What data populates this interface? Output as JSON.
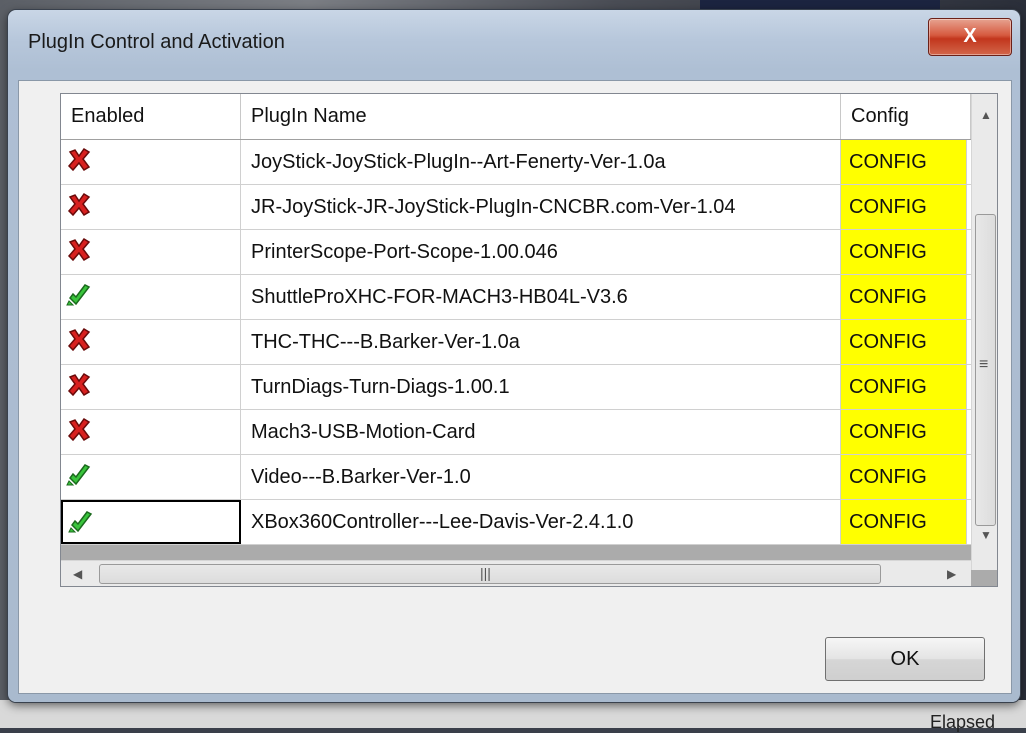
{
  "window": {
    "title": "PlugIn Control and Activation",
    "close_label": "X"
  },
  "grid": {
    "headers": {
      "enabled": "Enabled",
      "name": "PlugIn Name",
      "config": "Config"
    },
    "config_color": "#ffff00",
    "rows": [
      {
        "enabled": false,
        "name": "JoyStick-JoyStick-PlugIn--Art-Fenerty-Ver-1.0a",
        "config": "CONFIG"
      },
      {
        "enabled": false,
        "name": "JR-JoyStick-JR-JoyStick-PlugIn-CNCBR.com-Ver-1.04",
        "config": "CONFIG"
      },
      {
        "enabled": false,
        "name": "PrinterScope-Port-Scope-1.00.046",
        "config": "CONFIG"
      },
      {
        "enabled": true,
        "name": "ShuttleProXHC-FOR-MACH3-HB04L-V3.6",
        "config": "CONFIG"
      },
      {
        "enabled": false,
        "name": "THC-THC---B.Barker-Ver-1.0a",
        "config": "CONFIG"
      },
      {
        "enabled": false,
        "name": "TurnDiags-Turn-Diags-1.00.1",
        "config": "CONFIG"
      },
      {
        "enabled": false,
        "name": "Mach3-USB-Motion-Card",
        "config": "CONFIG"
      },
      {
        "enabled": true,
        "name": "Video---B.Barker-Ver-1.0",
        "config": "CONFIG"
      },
      {
        "enabled": true,
        "name": "XBox360Controller---Lee-Davis-Ver-2.4.1.0",
        "config": "CONFIG"
      }
    ],
    "icons": {
      "enabled": "check-icon",
      "disabled": "x-icon"
    }
  },
  "buttons": {
    "ok_label": "OK"
  },
  "background": {
    "text": "Elapsed"
  }
}
